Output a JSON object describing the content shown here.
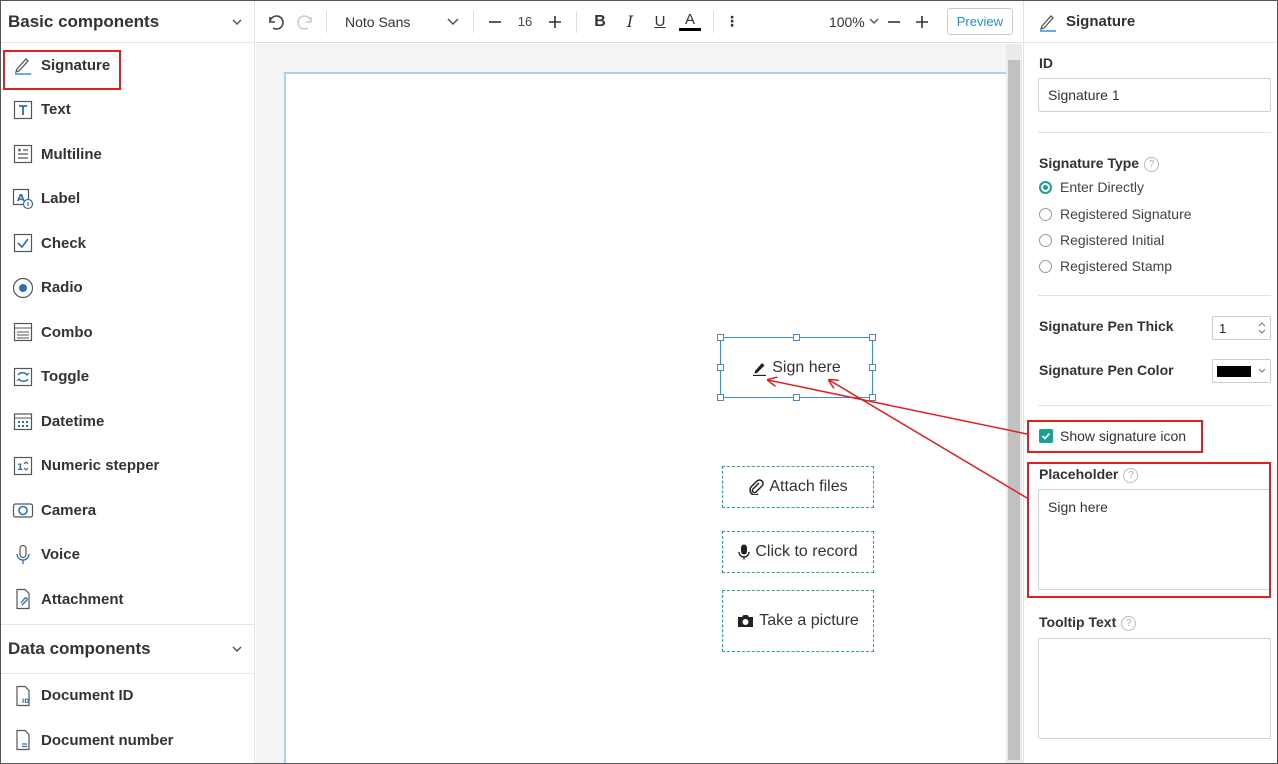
{
  "left_panel": {
    "basic_title": "Basic components",
    "basic_items": [
      {
        "label": "Signature",
        "icon": "signature-icon"
      },
      {
        "label": "Text",
        "icon": "text-icon"
      },
      {
        "label": "Multiline",
        "icon": "multiline-icon"
      },
      {
        "label": "Label",
        "icon": "label-icon"
      },
      {
        "label": "Check",
        "icon": "check-icon"
      },
      {
        "label": "Radio",
        "icon": "radio-icon"
      },
      {
        "label": "Combo",
        "icon": "combo-icon"
      },
      {
        "label": "Toggle",
        "icon": "toggle-icon"
      },
      {
        "label": "Datetime",
        "icon": "datetime-icon"
      },
      {
        "label": "Numeric stepper",
        "icon": "numeric-stepper-icon"
      },
      {
        "label": "Camera",
        "icon": "camera-icon"
      },
      {
        "label": "Voice",
        "icon": "voice-icon"
      },
      {
        "label": "Attachment",
        "icon": "attachment-icon"
      }
    ],
    "data_title": "Data components",
    "data_items": [
      {
        "label": "Document ID",
        "icon": "document-id-icon"
      },
      {
        "label": "Document number",
        "icon": "document-number-icon"
      }
    ]
  },
  "toolbar": {
    "font_family": "Noto Sans",
    "font_size": "16",
    "bold_label": "B",
    "italic_label": "I",
    "underline_label": "U",
    "color_label": "A",
    "more_label": "⋮",
    "zoom": "100%",
    "preview_label": "Preview"
  },
  "canvas": {
    "signature_placeholder": "Sign here",
    "attach_label": "Attach files",
    "record_label": "Click to record",
    "picture_label": "Take a picture"
  },
  "right_panel": {
    "title": "Signature",
    "id_label": "ID",
    "id_value": "Signature 1",
    "sig_type_label": "Signature Type",
    "sig_type_options": [
      "Enter Directly",
      "Registered Signature",
      "Registered Initial",
      "Registered Stamp"
    ],
    "selected_type": "Enter Directly",
    "pen_thick_label": "Signature Pen Thick",
    "pen_thick_value": "1",
    "pen_color_label": "Signature Pen Color",
    "pen_color_value": "#000000",
    "show_icon_label": "Show signature icon",
    "show_icon_checked": true,
    "placeholder_label": "Placeholder",
    "placeholder_value": "Sign here",
    "tooltip_label": "Tooltip Text",
    "tooltip_value": "",
    "help_glyph": "?"
  },
  "colors": {
    "accent_teal": "#1aa197",
    "selection_blue": "#3b8fd6",
    "annotation_red": "#e02020",
    "preview_blue": "#2a8bd8"
  }
}
